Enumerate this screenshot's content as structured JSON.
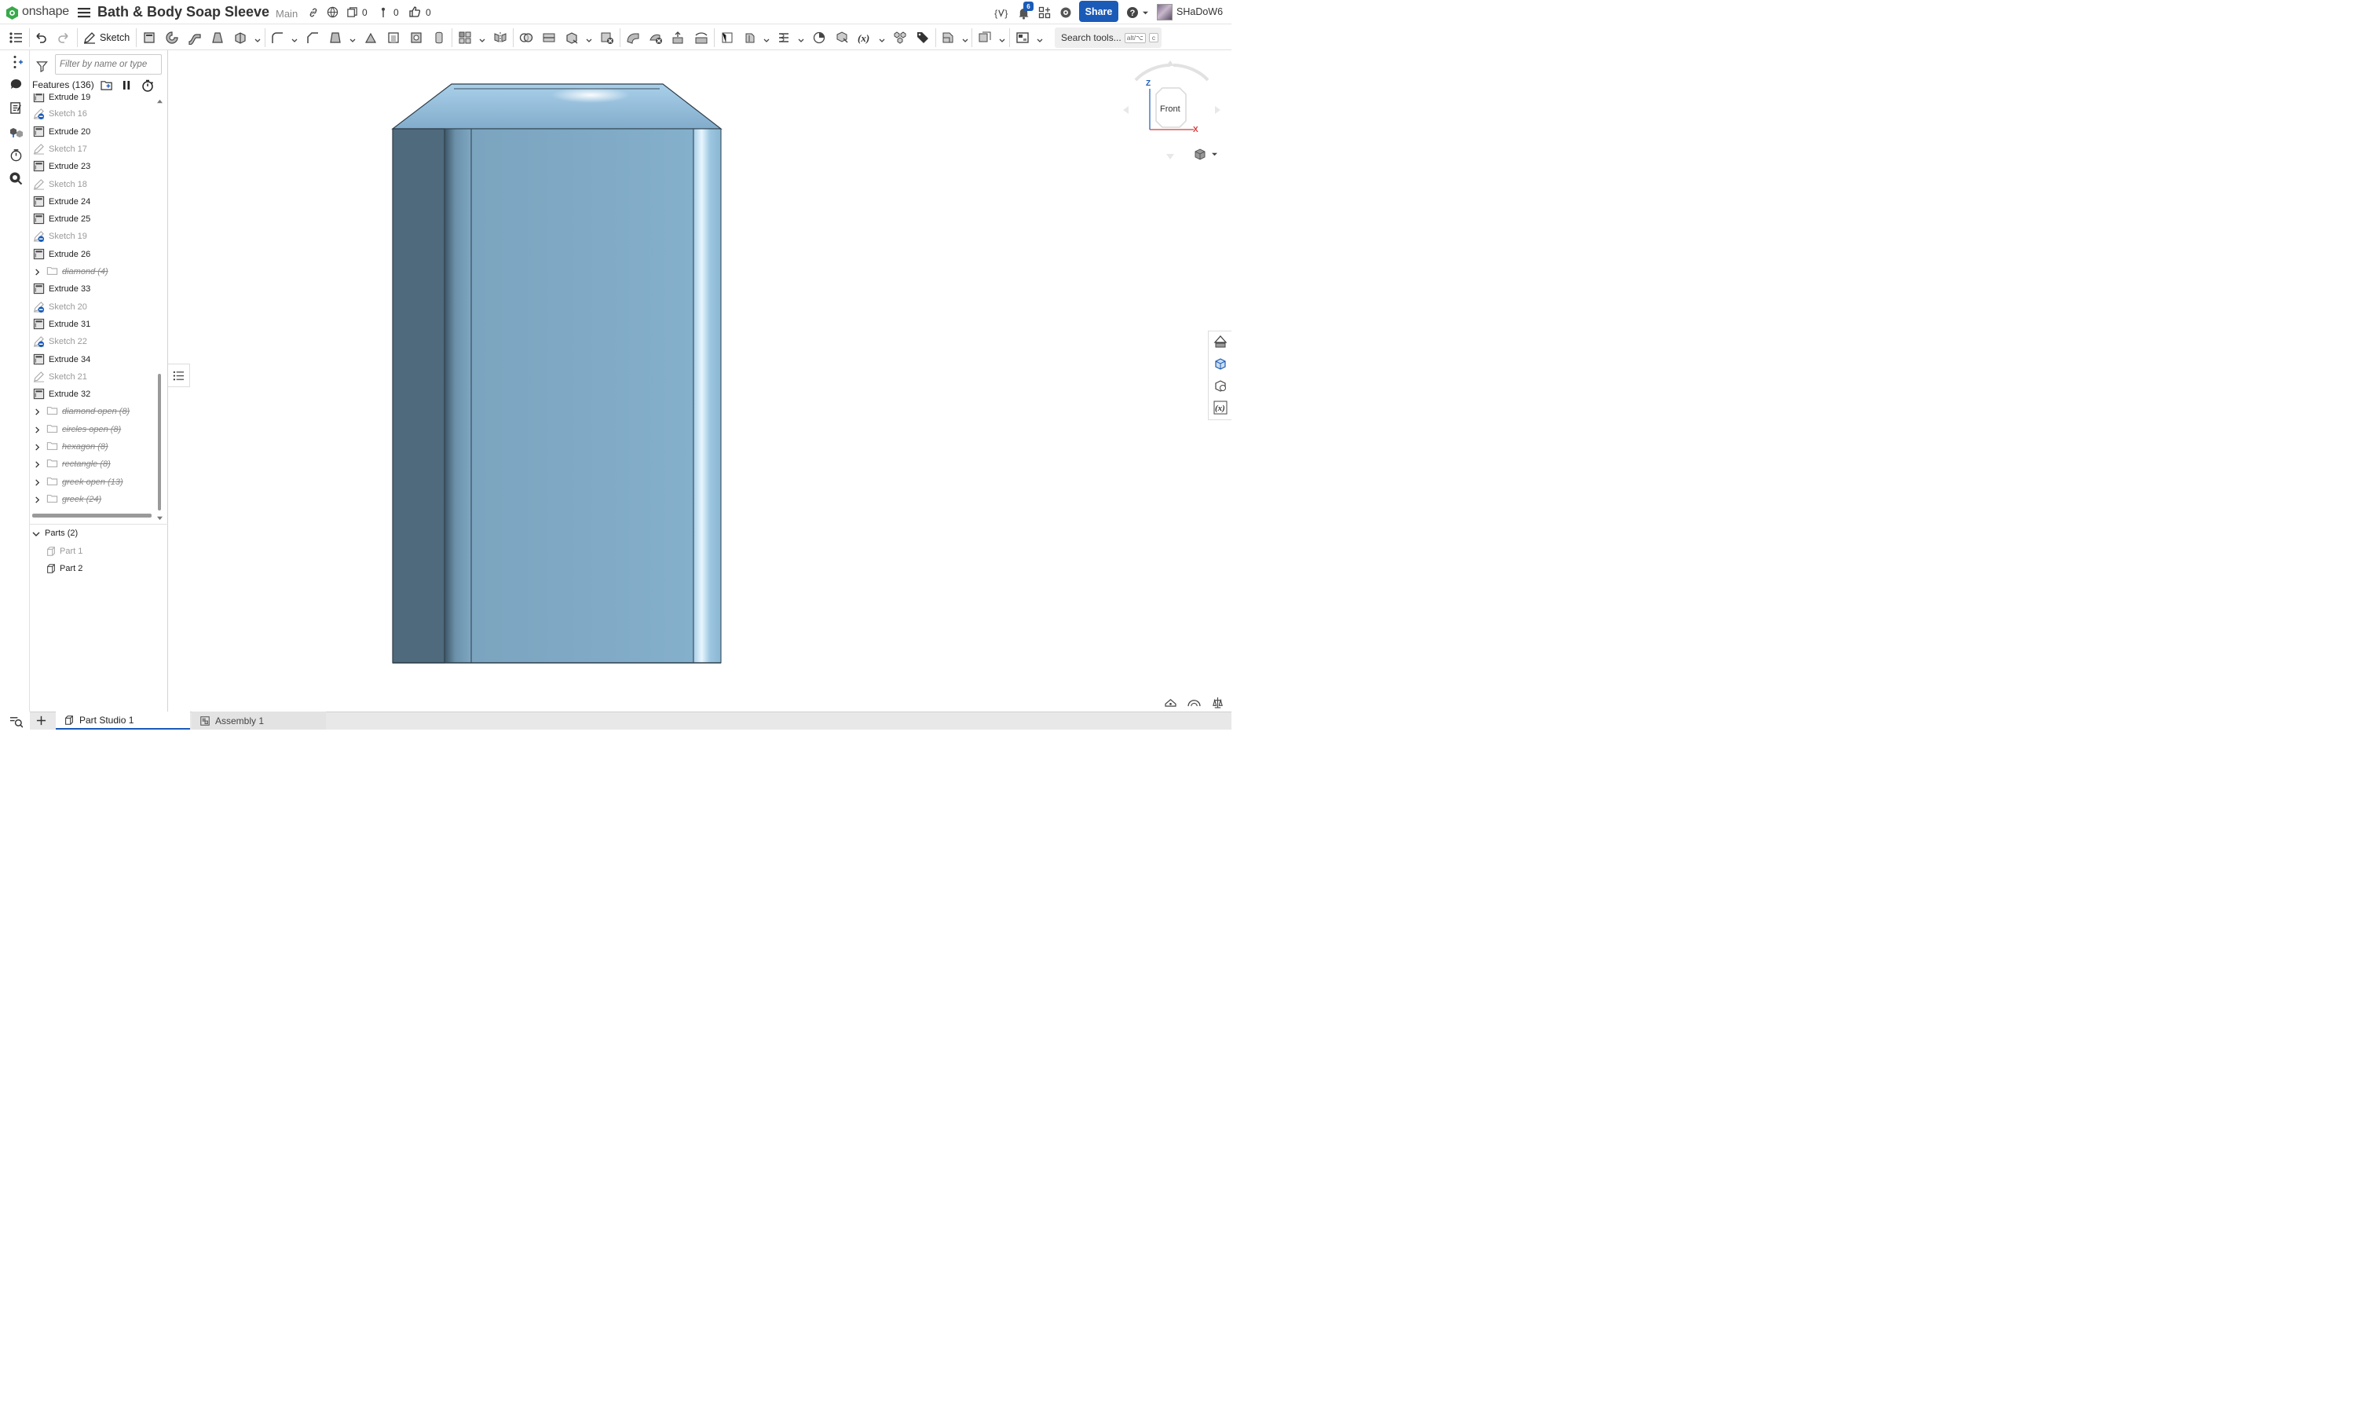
{
  "header": {
    "brand": "onshape",
    "doc_title": "Bath & Body Soap Sleeve",
    "branch": "Main",
    "counts": {
      "versions": "0",
      "branches": "0",
      "likes": "0"
    },
    "notification_count": "6",
    "share_label": "Share",
    "username": "SHaDoW6"
  },
  "toolbar": {
    "sketch_label": "Sketch",
    "search_label": "Search tools...",
    "search_shortcut_a": "alt/⌥",
    "search_shortcut_b": "c"
  },
  "features": {
    "filter_placeholder": "Filter by name or type",
    "header": "Features (136)",
    "items": [
      {
        "name": "Extrude 19",
        "type": "extrude",
        "state": "normal"
      },
      {
        "name": "Sketch 16",
        "type": "sketch-blocked",
        "state": "suppressed"
      },
      {
        "name": "Extrude 20",
        "type": "extrude",
        "state": "normal"
      },
      {
        "name": "Sketch 17",
        "type": "sketch",
        "state": "suppressed"
      },
      {
        "name": "Extrude 23",
        "type": "extrude",
        "state": "normal"
      },
      {
        "name": "Sketch 18",
        "type": "sketch",
        "state": "suppressed"
      },
      {
        "name": "Extrude 24",
        "type": "extrude",
        "state": "normal"
      },
      {
        "name": "Extrude 25",
        "type": "extrude",
        "state": "normal"
      },
      {
        "name": "Sketch 19",
        "type": "sketch-blocked",
        "state": "suppressed"
      },
      {
        "name": "Extrude 26",
        "type": "extrude",
        "state": "normal"
      },
      {
        "name": "diamond (4)",
        "type": "folder",
        "state": "folder"
      },
      {
        "name": "Extrude 33",
        "type": "extrude",
        "state": "normal"
      },
      {
        "name": "Sketch 20",
        "type": "sketch-blocked",
        "state": "suppressed"
      },
      {
        "name": "Extrude 31",
        "type": "extrude",
        "state": "normal"
      },
      {
        "name": "Sketch 22",
        "type": "sketch-blocked",
        "state": "suppressed"
      },
      {
        "name": "Extrude 34",
        "type": "extrude",
        "state": "normal"
      },
      {
        "name": "Sketch 21",
        "type": "sketch",
        "state": "suppressed"
      },
      {
        "name": "Extrude 32",
        "type": "extrude",
        "state": "normal"
      },
      {
        "name": "diamond open (8)",
        "type": "folder",
        "state": "folder"
      },
      {
        "name": "circles open (8)",
        "type": "folder",
        "state": "folder"
      },
      {
        "name": "hexagon (8)",
        "type": "folder",
        "state": "folder"
      },
      {
        "name": "rectangle (8)",
        "type": "folder",
        "state": "folder"
      },
      {
        "name": "greek open (13)",
        "type": "folder",
        "state": "folder"
      },
      {
        "name": "greek (24)",
        "type": "folder",
        "state": "folder"
      }
    ]
  },
  "parts": {
    "header": "Parts (2)",
    "items": [
      "Part 1",
      "Part 2"
    ]
  },
  "view_cube": {
    "face": "Front",
    "axis_z": "Z",
    "axis_x": "X"
  },
  "tabs": [
    {
      "label": "Part Studio 1",
      "active": true
    },
    {
      "label": "Assembly 1",
      "active": false
    }
  ],
  "colors": {
    "accent": "#1a5bb8",
    "onshape_green": "#39a94b",
    "model_face": "#7ea8c3",
    "model_dark": "#4f6a7c",
    "model_light": "#8fbcd8"
  }
}
